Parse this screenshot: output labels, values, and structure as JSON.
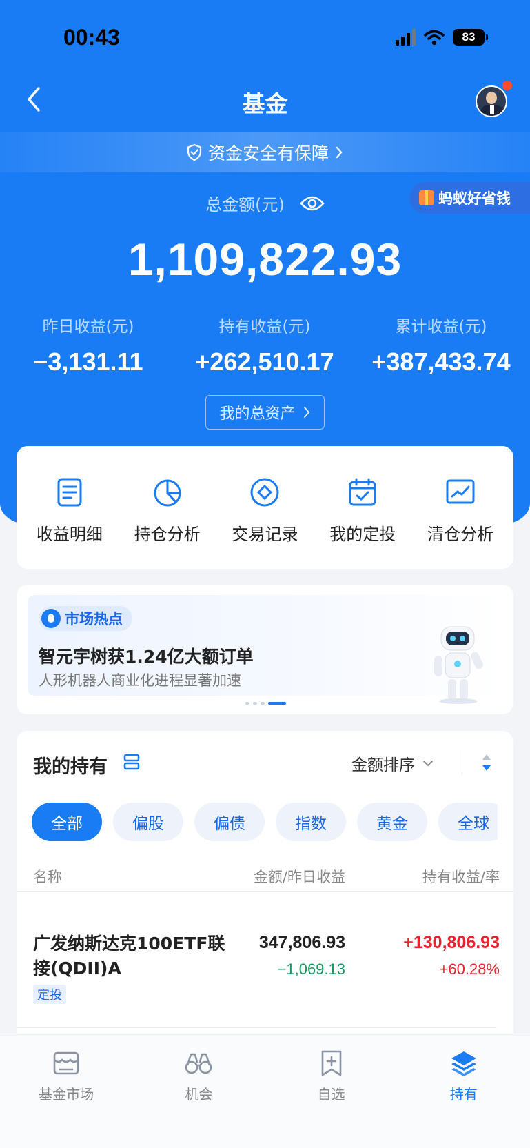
{
  "status": {
    "time": "00:43",
    "battery": "83"
  },
  "header": {
    "title": "基金"
  },
  "security": {
    "text": "资金安全有保障"
  },
  "summary": {
    "total_label": "总金额(元)",
    "total_amount": "1,109,822.93",
    "promo": "蚂蚁好省钱",
    "stats": [
      {
        "label": "昨日收益(元)",
        "value": "−3,131.11"
      },
      {
        "label": "持有收益(元)",
        "value": "+262,510.17"
      },
      {
        "label": "累计收益(元)",
        "value": "+387,433.74"
      }
    ],
    "assets_button": "我的总资产"
  },
  "menu": [
    {
      "label": "收益明细",
      "icon": "document-icon"
    },
    {
      "label": "持仓分析",
      "icon": "pie-chart-icon"
    },
    {
      "label": "交易记录",
      "icon": "record-icon"
    },
    {
      "label": "我的定投",
      "icon": "calendar-icon"
    },
    {
      "label": "清仓分析",
      "icon": "trend-chart-icon"
    }
  ],
  "news": {
    "tag": "市场热点",
    "title": "智元宇树获1.24亿大额订单",
    "subtitle": "人形机器人商业化进程显著加速",
    "page_count": 4,
    "active_page": 4
  },
  "holdings": {
    "title": "我的持有",
    "sort_label": "金额排序",
    "filters": [
      "全部",
      "偏股",
      "偏债",
      "指数",
      "黄金",
      "全球"
    ],
    "active_filter": 0,
    "columns": {
      "name": "名称",
      "amount": "金额/昨日收益",
      "gain": "持有收益/率"
    },
    "funds": [
      {
        "name": "广发纳斯达克100ETF联接(QDII)A",
        "tag": "定投",
        "amount": "347,806.93",
        "yesterday": "−1,069.13",
        "gain": "+130,806.93",
        "rate": "+60.28%"
      }
    ]
  },
  "tabbar": [
    {
      "label": "基金市场",
      "icon": "market-icon"
    },
    {
      "label": "机会",
      "icon": "binoculars-icon"
    },
    {
      "label": "自选",
      "icon": "bookmark-add-icon"
    },
    {
      "label": "持有",
      "icon": "layers-icon",
      "active": true
    }
  ],
  "colors": {
    "brand": "#1a7cf5",
    "gain": "#e8232f",
    "loss": "#0f9b5e"
  }
}
